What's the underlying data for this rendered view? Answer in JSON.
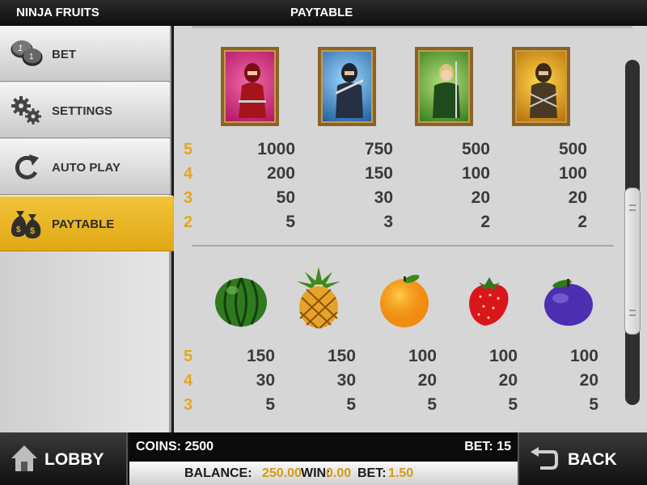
{
  "header": {
    "game_title": "NINJA FRUITS",
    "page_title": "PAYTABLE"
  },
  "sidebar": {
    "items": [
      {
        "label": "BET",
        "icon": "coins-icon"
      },
      {
        "label": "SETTINGS",
        "icon": "gears-icon"
      },
      {
        "label": "AUTO PLAY",
        "icon": "replay-icon"
      },
      {
        "label": "PAYTABLE",
        "icon": "money-bags-icon",
        "active": true
      }
    ]
  },
  "paytable": {
    "ninjas": {
      "multipliers": [
        "5",
        "4",
        "3",
        "2"
      ],
      "symbols": [
        {
          "name": "red-ninja",
          "pays": [
            "1000",
            "200",
            "50",
            "5"
          ]
        },
        {
          "name": "blue-ninja",
          "pays": [
            "750",
            "150",
            "30",
            "3"
          ]
        },
        {
          "name": "green-ninja",
          "pays": [
            "500",
            "100",
            "20",
            "2"
          ]
        },
        {
          "name": "gold-ninja",
          "pays": [
            "500",
            "100",
            "20",
            "2"
          ]
        }
      ]
    },
    "fruits": {
      "multipliers": [
        "5",
        "4",
        "3"
      ],
      "symbols": [
        {
          "name": "watermelon",
          "pays": [
            "150",
            "30",
            "5"
          ]
        },
        {
          "name": "pineapple",
          "pays": [
            "150",
            "30",
            "5"
          ]
        },
        {
          "name": "orange",
          "pays": [
            "100",
            "20",
            "5"
          ]
        },
        {
          "name": "strawberry",
          "pays": [
            "100",
            "20",
            "5"
          ]
        },
        {
          "name": "plum",
          "pays": [
            "100",
            "20",
            "5"
          ]
        }
      ]
    }
  },
  "footer": {
    "lobby_label": "LOBBY",
    "back_label": "BACK",
    "coins_label": "COINS:",
    "coins_value": "2500",
    "bet_label": "BET:",
    "bet_value": "15",
    "balance_label": "BALANCE:",
    "balance_value": "250.00",
    "win_label": "WIN:",
    "win_value": "0.00",
    "bottom_bet_label": "BET:",
    "bottom_bet_value": "1.50"
  },
  "colors": {
    "accent": "#e3ad1b",
    "multiplier": "#e2a622"
  }
}
